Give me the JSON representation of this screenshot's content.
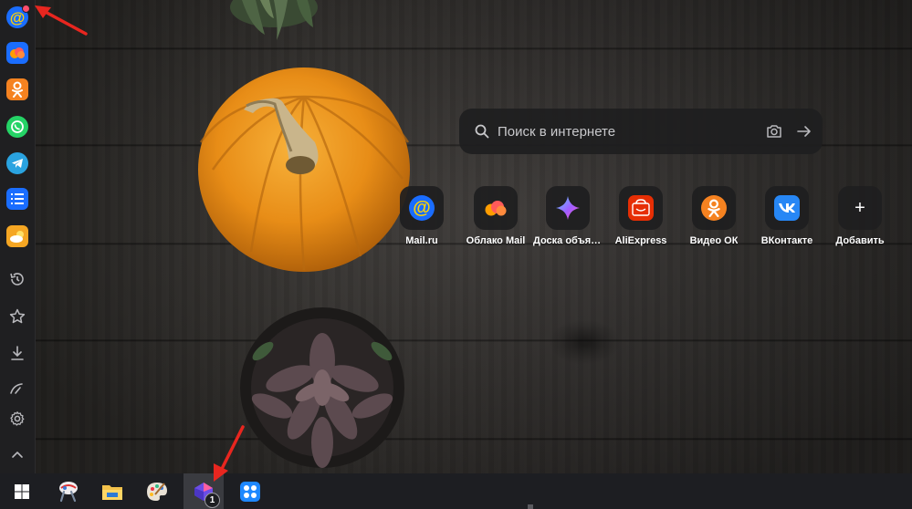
{
  "search": {
    "placeholder": "Поиск в интернете"
  },
  "tiles": [
    {
      "label": "Mail.ru",
      "icon": "mailru-icon"
    },
    {
      "label": "Облако Mail",
      "icon": "cloud-icon"
    },
    {
      "label": "Доска объявлений",
      "icon": "sparkle-icon"
    },
    {
      "label": "AliExpress",
      "icon": "aliexpress-icon"
    },
    {
      "label": "Видео ОК",
      "icon": "ok-icon"
    },
    {
      "label": "ВКонтакте",
      "icon": "vk-icon"
    },
    {
      "label": "Добавить",
      "icon": "plus-icon"
    }
  ],
  "taskbar": {
    "badge_count": "1"
  },
  "colors": {
    "mail_blue": "#1a6dff",
    "ok_orange": "#f58220",
    "vk_blue": "#2787f5",
    "whatsapp_green": "#25d366",
    "telegram_blue": "#2aa3e0",
    "ali_red": "#e62e04",
    "annotation_red": "#e8261f"
  }
}
